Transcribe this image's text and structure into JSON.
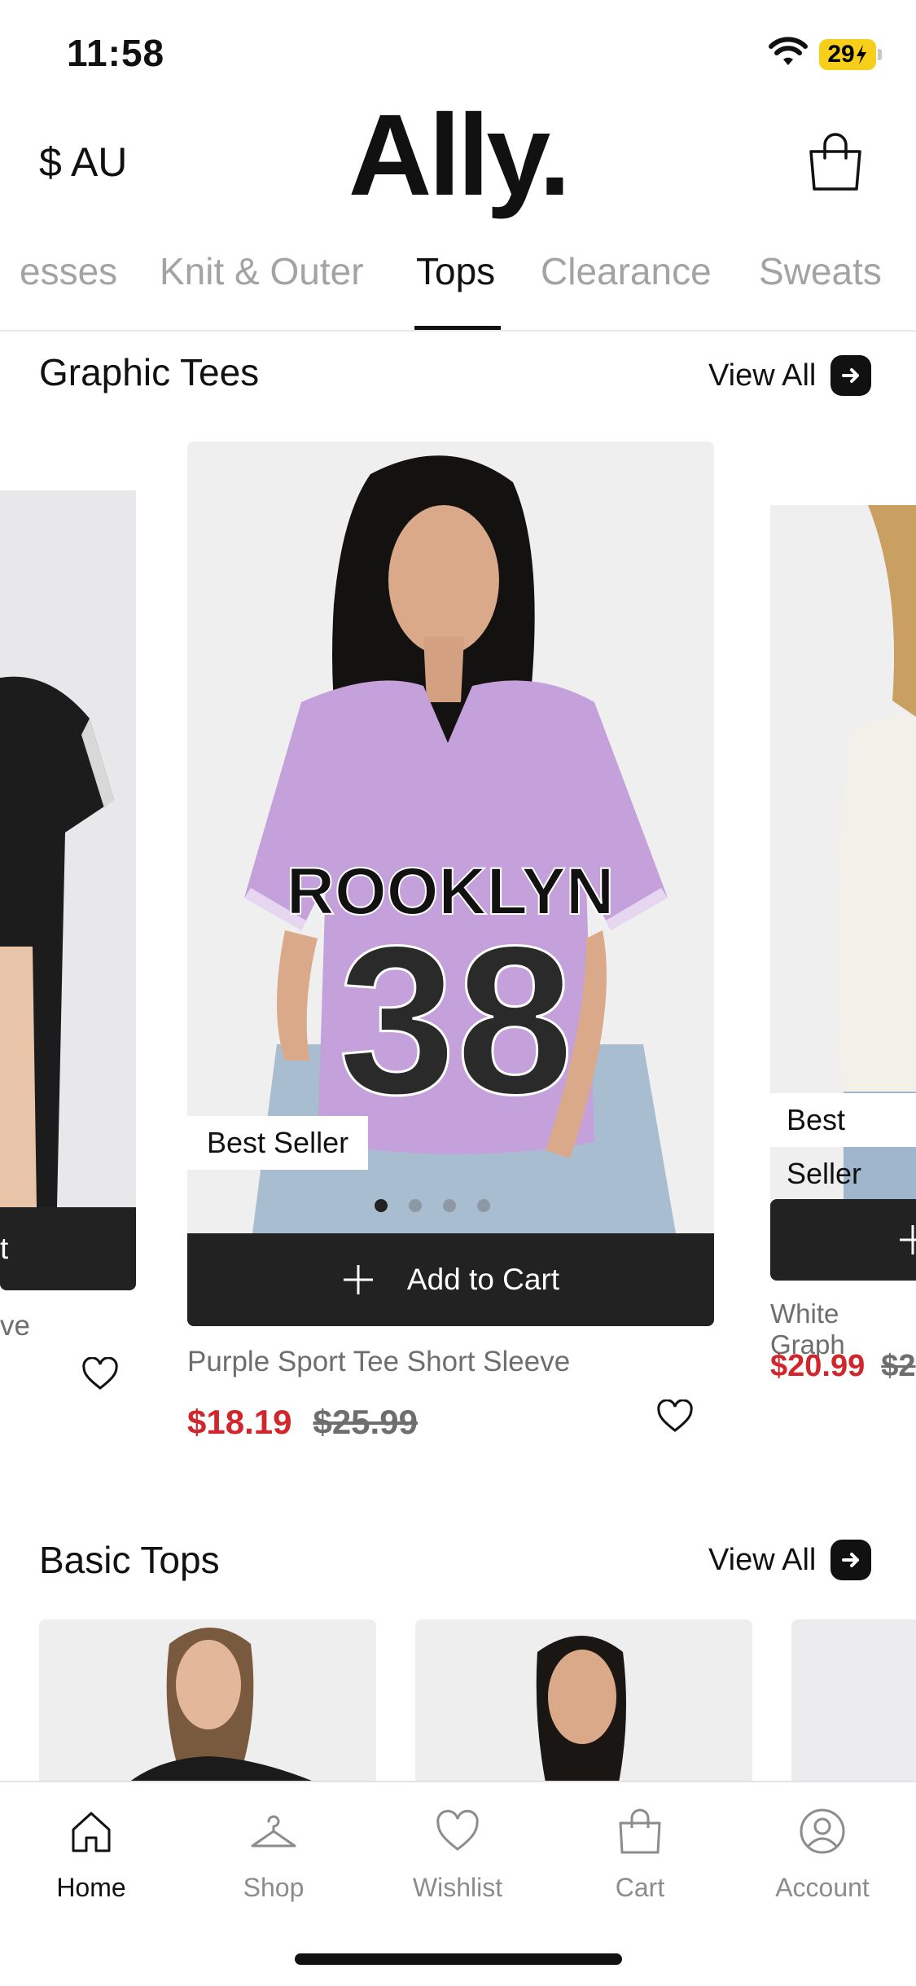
{
  "status": {
    "time": "11:58",
    "battery": "29"
  },
  "header": {
    "currency": "$ AU",
    "logo": "Ally."
  },
  "tabs": [
    {
      "label": "esses"
    },
    {
      "label": "Knit & Outer"
    },
    {
      "label": "Tops"
    },
    {
      "label": "Clearance"
    },
    {
      "label": "Sweats"
    }
  ],
  "active_tab": "Tops",
  "graphic_tees": {
    "title": "Graphic Tees",
    "view_all": "View All",
    "left_card": {
      "cart_label_fragment": "t",
      "name_fragment": "ve"
    },
    "main_card": {
      "badge": "Best Seller",
      "cart_label": "Add to Cart",
      "name": "Purple Sport Tee Short Sleeve",
      "price": "$18.19",
      "original_price": "$25.99",
      "jersey_text": "ROOKLYN",
      "jersey_number": "38"
    },
    "right_card": {
      "badge": "Best Seller",
      "name": "White Graph",
      "price": "$20.99",
      "original_price": "$2"
    }
  },
  "basic_tops": {
    "title": "Basic Tops",
    "view_all": "View All"
  },
  "bottom_nav": [
    {
      "label": "Home",
      "icon": "home-icon"
    },
    {
      "label": "Shop",
      "icon": "hanger-icon"
    },
    {
      "label": "Wishlist",
      "icon": "heart-icon"
    },
    {
      "label": "Cart",
      "icon": "bag-icon"
    },
    {
      "label": "Account",
      "icon": "user-icon"
    }
  ],
  "colors": {
    "sale": "#d0262c",
    "dark": "#222222",
    "muted": "#a3a3a3"
  }
}
